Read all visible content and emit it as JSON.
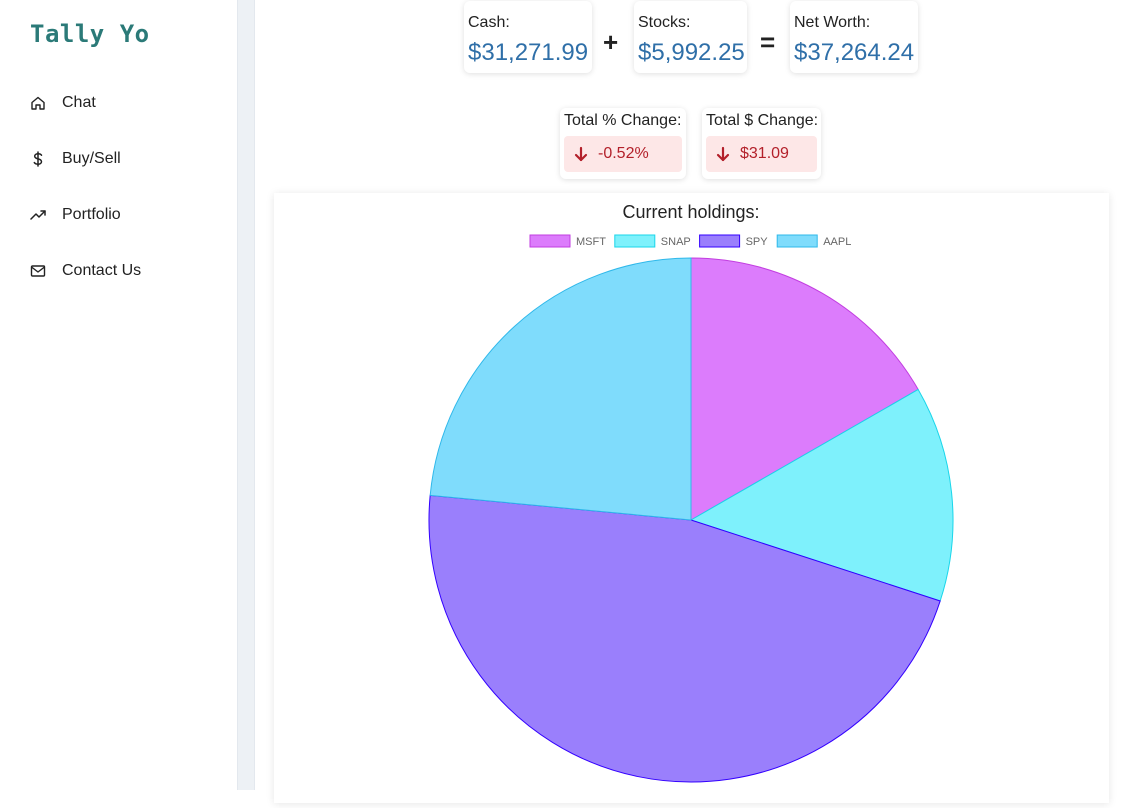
{
  "app": {
    "brand": "Tally Yo"
  },
  "sidebar": {
    "items": [
      {
        "label": "Chat",
        "icon": "home-icon"
      },
      {
        "label": "Buy/Sell",
        "icon": "dollar-icon"
      },
      {
        "label": "Portfolio",
        "icon": "trending-up-icon"
      },
      {
        "label": "Contact Us",
        "icon": "mail-icon"
      }
    ]
  },
  "summary": {
    "cash": {
      "label": "Cash:",
      "value": "$31,271.99"
    },
    "plus": "+",
    "stocks": {
      "label": "Stocks:",
      "value": "$5,992.25"
    },
    "equals": "=",
    "net_worth": {
      "label": "Net Worth:",
      "value": "$37,264.24"
    }
  },
  "changes": {
    "percent": {
      "label": "Total % Change:",
      "value": "-0.52%",
      "direction": "down"
    },
    "dollar": {
      "label": "Total $ Change:",
      "value": "$31.09",
      "direction": "down"
    }
  },
  "colors": {
    "accent": "#2f6fa8",
    "brand": "#2b7a78",
    "negative": "#b3202a",
    "negative_bg": "#fde7e7"
  },
  "chart_data": {
    "type": "pie",
    "title": "Current holdings:",
    "legend": "top",
    "categories": [
      "MSFT",
      "SNAP",
      "SPY",
      "AAPL"
    ],
    "values": [
      16.7,
      13.3,
      46.5,
      23.5
    ],
    "colors": [
      "#dc7cfc",
      "#7ef1fc",
      "#9a7ffc",
      "#7fdcfc"
    ],
    "borders": [
      "#c23ee0",
      "#19d6ea",
      "#3300ff",
      "#2fb8ea"
    ]
  }
}
